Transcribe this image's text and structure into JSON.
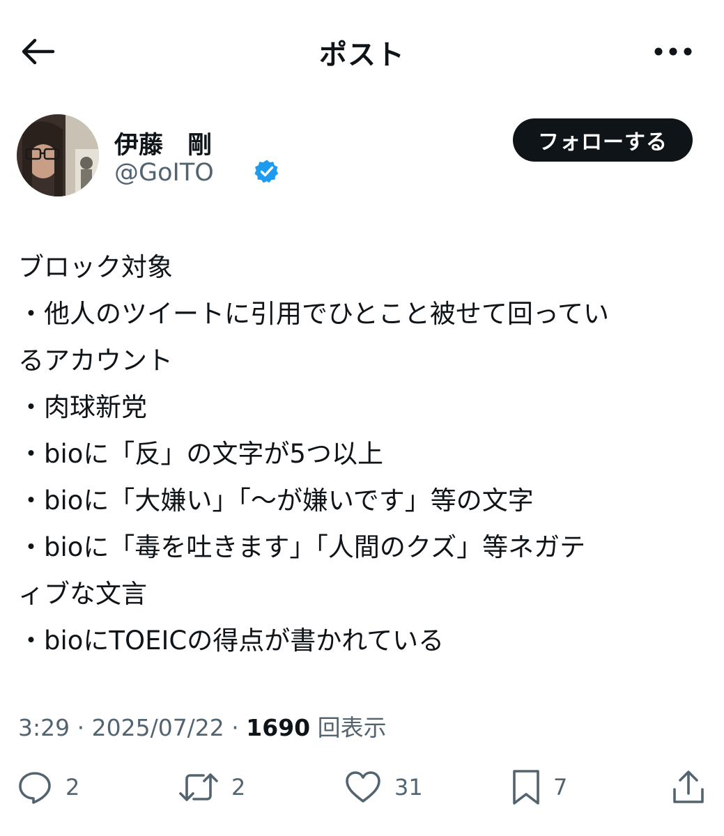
{
  "header": {
    "title": "ポスト"
  },
  "author": {
    "display_name": "伊藤　剛",
    "handle": "@GoITO",
    "follow_label": "フォローする"
  },
  "post": {
    "lines": [
      "ブロック対象",
      "・他人のツイートに引用でひとこと被せて回ってい",
      "るアカウント",
      "・肉球新党",
      "・bioに「反」の文字が5つ以上",
      "・bioに「大嫌い」「〜が嫌いです」等の文字",
      "・bioに「毒を吐きます」「人間のクズ」等ネガテ",
      "ィブな文言",
      "・bioにTOEICの得点が書かれている"
    ]
  },
  "meta": {
    "time": "3:29",
    "separator": " · ",
    "date": "2025/07/22",
    "views_count": "1690",
    "views_label": "回表示"
  },
  "actions": {
    "reply_count": "2",
    "retweet_count": "2",
    "like_count": "31",
    "bookmark_count": "7"
  },
  "colors": {
    "text": "#0f1419",
    "secondary": "#536471",
    "verified": "#1d9bf0",
    "follow_bg": "#0f1419"
  }
}
